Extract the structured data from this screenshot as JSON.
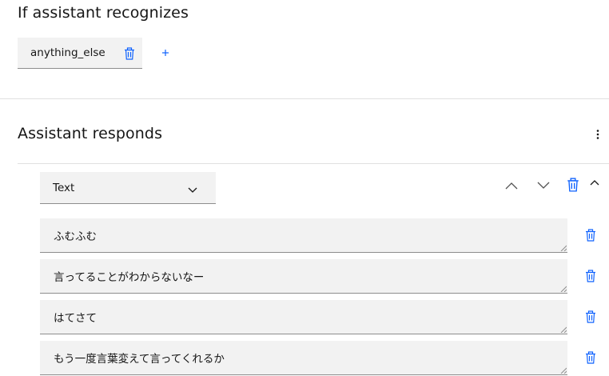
{
  "condition": {
    "title": "If assistant recognizes",
    "chip_label": "anything_else",
    "add_icon": "plus-icon",
    "delete_icon": "trash-icon"
  },
  "response": {
    "title": "Assistant responds",
    "menu_icon": "overflow-menu-vertical-icon",
    "type_select": {
      "selected": "Text"
    },
    "variations": [
      {
        "value": "ふむふむ"
      },
      {
        "value": "言ってることがわからないなー"
      },
      {
        "value": "はてさて"
      },
      {
        "value": "もう一度言葉変えて言ってくれるか"
      }
    ]
  },
  "colors": {
    "accent": "#0f62fe",
    "field_bg": "#f2f2f2",
    "divider": "#e0e0e0"
  }
}
